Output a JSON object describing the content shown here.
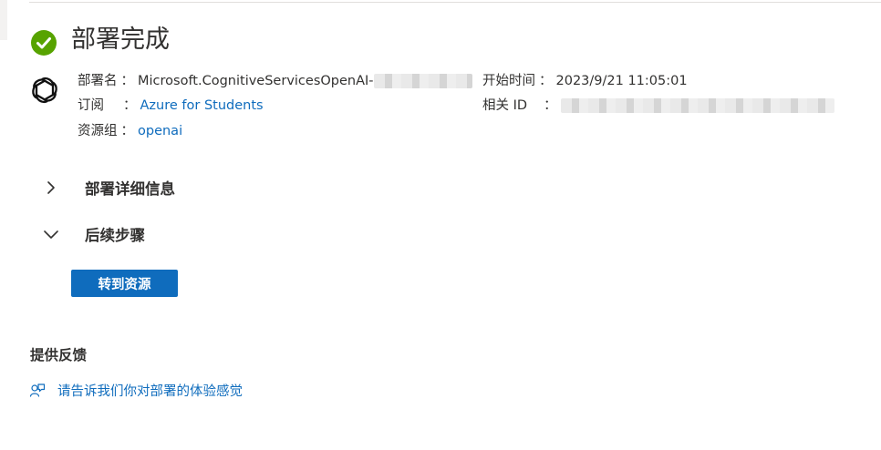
{
  "header": {
    "title": "部署完成",
    "status_icon": "check-circle-icon",
    "status_color": "#57a300"
  },
  "deployment": {
    "service_icon": "openai-icon",
    "name_label": "部署名",
    "name_value": "Microsoft.CognitiveServicesOpenAI-",
    "subscription_label": "订阅",
    "subscription_value": "Azure for Students",
    "resource_group_label": "资源组",
    "resource_group_value": "openai",
    "start_time_label": "开始时间",
    "start_time_value": "2023/9/21 11:05:01",
    "correlation_id_label": "相关 ID",
    "separator": "："
  },
  "sections": {
    "details_label": "部署详细信息",
    "next_steps_label": "后续步骤"
  },
  "actions": {
    "go_to_resource_label": "转到资源",
    "accent_color": "#0f6cbd"
  },
  "feedback": {
    "title": "提供反馈",
    "link_label": "请告诉我们你对部署的体验感觉",
    "icon": "feedback-person-icon"
  }
}
